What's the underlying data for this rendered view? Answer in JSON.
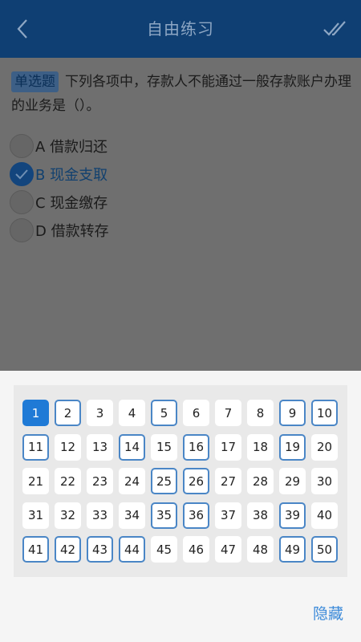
{
  "header": {
    "title": "自由练习",
    "back_icon": "chevron-left-icon",
    "submit_icon": "double-check-icon"
  },
  "question": {
    "type_tag": "单选题",
    "text": "下列各项中，存款人不能通过一般存款账户办理的业务是（）。",
    "options": [
      {
        "letter": "A",
        "label": "借款归还",
        "selected": false
      },
      {
        "letter": "B",
        "label": "现金支取",
        "selected": true
      },
      {
        "letter": "C",
        "label": "现金缴存",
        "selected": false
      },
      {
        "letter": "D",
        "label": "借款转存",
        "selected": false
      }
    ]
  },
  "answer_sheet": {
    "current": 1,
    "answered": [
      2,
      5,
      9,
      10,
      11,
      14,
      16,
      19,
      25,
      26,
      35,
      36,
      39,
      41,
      42,
      43,
      44,
      49,
      50
    ],
    "numbers": [
      "1",
      "2",
      "3",
      "4",
      "5",
      "6",
      "7",
      "8",
      "9",
      "10",
      "11",
      "12",
      "13",
      "14",
      "15",
      "16",
      "17",
      "18",
      "19",
      "20",
      "21",
      "22",
      "23",
      "24",
      "25",
      "26",
      "27",
      "28",
      "29",
      "30",
      "31",
      "32",
      "33",
      "34",
      "35",
      "36",
      "37",
      "38",
      "39",
      "40",
      "41",
      "42",
      "43",
      "44",
      "45",
      "46",
      "47",
      "48",
      "49",
      "50"
    ]
  },
  "footer": {
    "hide_label": "隐藏"
  },
  "colors": {
    "header_bg": "#0f3f73",
    "accent": "#3b8ad9",
    "current_cell": "#1f7ad6",
    "answered_border": "#4a86c6"
  }
}
